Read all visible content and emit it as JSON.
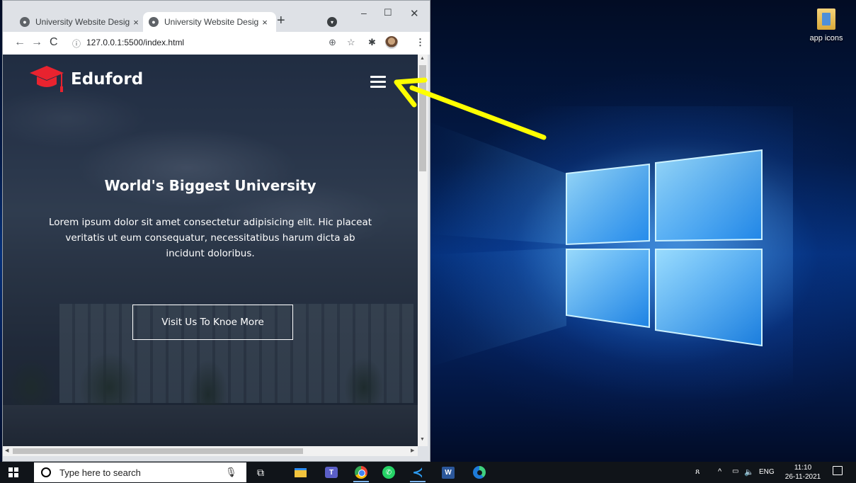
{
  "browser": {
    "tabs": [
      {
        "title": "University Website Design",
        "close": "×",
        "active": false
      },
      {
        "title": "University Website Design",
        "close": "×",
        "active": true
      }
    ],
    "new_tab": "+",
    "window_controls": {
      "minimize": "–",
      "maximize": "☐",
      "close": "✕"
    },
    "nav": {
      "back": "←",
      "forward": "→",
      "reload": "C"
    },
    "address": {
      "info_icon": "ⓘ",
      "url": "127.0.0.1:5500/index.html"
    },
    "toolbar_icons": [
      "zoom-icon",
      "star-icon",
      "extensions-icon",
      "profile-avatar",
      "menu-icon"
    ],
    "toolbar_glyphs": {
      "zoom": "⊕",
      "star": "☆",
      "extensions": "✱",
      "menu": "⋮"
    }
  },
  "site": {
    "brand": "Eduford",
    "hero": {
      "title": "World's Biggest University",
      "text": "Lorem ipsum dolor sit amet consectetur adipisicing elit. Hic placeat veritatis ut eum consequatur, necessitatibus harum dicta ab incidunt doloribus.",
      "cta": "Visit Us To Knoe More"
    },
    "colors": {
      "brand_accent": "#e8232f",
      "overlay": "#0f192d"
    }
  },
  "desktop": {
    "icons": [
      {
        "label": "app icons",
        "icon": "folder-icon"
      }
    ]
  },
  "annotation": {
    "arrow_color": "#ffff00",
    "points_to": "hamburger-menu-button"
  },
  "taskbar": {
    "search_placeholder": "Type here to search",
    "pinned_apps": [
      "task-view",
      "file-explorer",
      "microsoft-teams",
      "google-chrome",
      "whatsapp",
      "visual-studio-code",
      "microsoft-word",
      "microsoft-edge"
    ],
    "tray": {
      "people": "ጸ",
      "chevron": "^",
      "battery": "▭",
      "volume": "🔈",
      "language": "ENG",
      "time": "11:10",
      "date": "26-11-2021"
    }
  }
}
